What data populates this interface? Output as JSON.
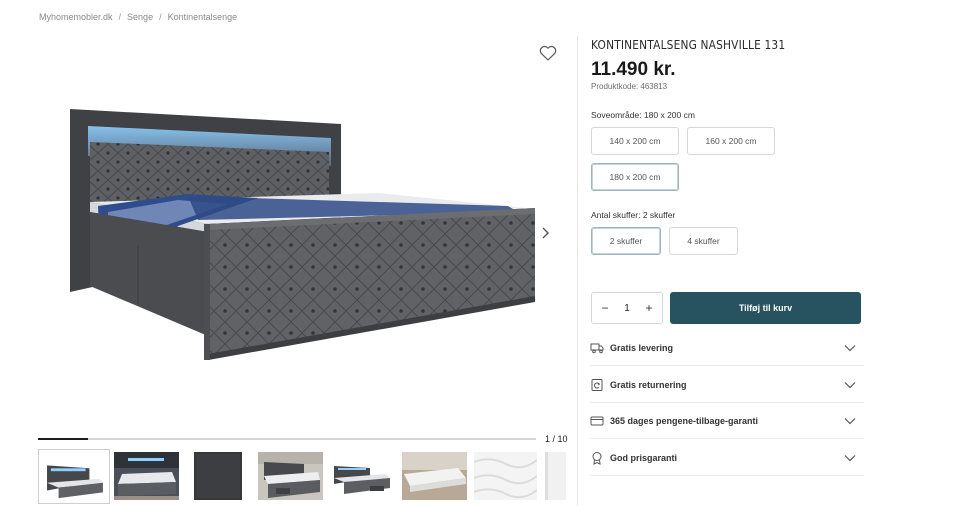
{
  "breadcrumb": {
    "items": [
      "Myhomemobler.dk",
      "Senge",
      "Kontinentalsenge"
    ],
    "separator": "/"
  },
  "product": {
    "title": "KONTINENTALSENG NASHVILLE 131",
    "price": "11.490 kr.",
    "sku": "Produktkode: 463813"
  },
  "gallery": {
    "counter": "1 / 10",
    "progress": 0.1,
    "icons": {
      "wishlist": "heart-icon",
      "next": "chevron-right-icon"
    },
    "thumbnails": [
      "bed-front",
      "bed-bedroom",
      "fabric-swatch",
      "bed-drawers-room",
      "bed-drawers",
      "mattress-floor",
      "mattress-closeup",
      "mattress-partial"
    ]
  },
  "options": {
    "sleeping_area": {
      "label": "Soveområde: 180 x 200 cm",
      "choices": [
        "140 x 200 cm",
        "160 x 200 cm",
        "180 x 200 cm"
      ],
      "selected": "180 x 200 cm"
    },
    "drawers": {
      "label": "Antal skuffer: 2 skuffer",
      "choices": [
        "2 skuffer",
        "4 skuffer"
      ],
      "selected": "2 skuffer"
    }
  },
  "cart": {
    "quantity": "1",
    "minus": "−",
    "plus": "+",
    "add_label": "Tilføj til kurv"
  },
  "accordion": [
    {
      "label": "Gratis levering",
      "icon": "truck-icon"
    },
    {
      "label": "Gratis returnering",
      "icon": "return-icon"
    },
    {
      "label": "365 dages pengene-tilbage-garanti",
      "icon": "card-icon"
    },
    {
      "label": "God prisgaranti",
      "icon": "badge-icon"
    }
  ],
  "colors": {
    "accent": "#26535f",
    "bed_fabric": "#5d5f63",
    "led": "#7fc7ff",
    "text": "#222222"
  }
}
